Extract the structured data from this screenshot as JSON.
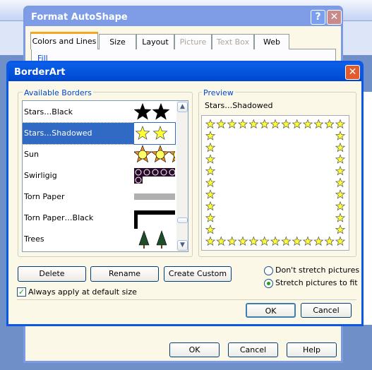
{
  "format_dialog": {
    "title": "Format AutoShape",
    "tabs": [
      {
        "label": "Colors and Lines",
        "enabled": true,
        "selected": true
      },
      {
        "label": "Size",
        "enabled": true
      },
      {
        "label": "Layout",
        "enabled": true
      },
      {
        "label": "Picture",
        "enabled": false
      },
      {
        "label": "Text Box",
        "enabled": false
      },
      {
        "label": "Web",
        "enabled": true
      }
    ],
    "section": "Fill",
    "ok": "OK",
    "cancel": "Cancel",
    "help": "Help"
  },
  "borderart": {
    "title": "BorderArt",
    "available_label": "Available Borders",
    "items": [
      {
        "label": "Stars…Black",
        "icon": "black-stars"
      },
      {
        "label": "Stars…Shadowed",
        "icon": "yellow-stars",
        "selected": true
      },
      {
        "label": "Sun",
        "icon": "suns"
      },
      {
        "label": "Swirligig",
        "icon": "swirls"
      },
      {
        "label": "Torn Paper",
        "icon": "gray-torn-paper"
      },
      {
        "label": "Torn Paper…Black",
        "icon": "black-torn-paper"
      },
      {
        "label": "Trees",
        "icon": "trees"
      }
    ],
    "preview_label": "Preview",
    "preview_name": "Stars…Shadowed",
    "delete": "Delete",
    "rename": "Rename",
    "create_custom": "Create Custom",
    "radio_dont_stretch": "Don't stretch pictures",
    "radio_stretch": "Stretch pictures to fit",
    "stretch_selected": true,
    "checkbox_label": "Always apply at default size",
    "checkbox_checked": true,
    "ok": "OK",
    "cancel": "Cancel"
  },
  "colors": {
    "title_active": "#0a58e4",
    "title_inactive": "#7f9ce6",
    "selection": "#316ac5",
    "star": "#ffff33"
  }
}
